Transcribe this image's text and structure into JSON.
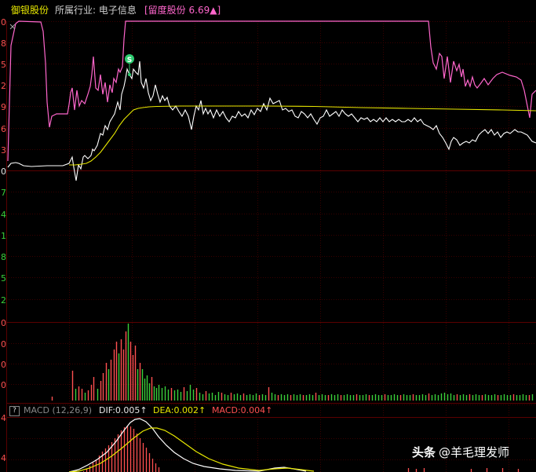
{
  "header": {
    "stock_name": "御银股份",
    "industry_label": "所属行业: 电子信息",
    "compare_label": "[留度股份 6.69▲]"
  },
  "price_axis": {
    "labels": [
      "0",
      "8",
      "5",
      "2",
      "9",
      "6",
      "3",
      "0",
      "7",
      "4",
      "1",
      "8",
      "5",
      "2"
    ],
    "colors": [
      "#ff5050",
      "#ff5050",
      "#ff5050",
      "#ff5050",
      "#ff5050",
      "#ff5050",
      "#ff5050",
      "#e6e6e6",
      "#3ad03a",
      "#3ad03a",
      "#3ad03a",
      "#3ad03a",
      "#3ad03a",
      "#3ad03a"
    ]
  },
  "volume_axis": {
    "labels": [
      "0",
      "0",
      "0",
      "0"
    ]
  },
  "macd_axis": {
    "labels": [
      "4",
      "4"
    ]
  },
  "macd_header": {
    "help": "?",
    "name": "MACD (12,26,9)",
    "dif": "DIF:0.005↑",
    "dea": "DEA:0.002↑",
    "macd": "MACD:0.004↑"
  },
  "markers": {
    "buy_signal": "S"
  },
  "watermark": {
    "brand": "头条",
    "account": "@羊毛理发师"
  },
  "colors": {
    "background": "#000000",
    "grid": "#3a0000",
    "price_line": "#ffffff",
    "avg_line": "#e8e800",
    "compare_line": "#ff66cc",
    "up": "#ff5050",
    "down": "#3ad03a",
    "signal": "#2ecc71"
  }
}
